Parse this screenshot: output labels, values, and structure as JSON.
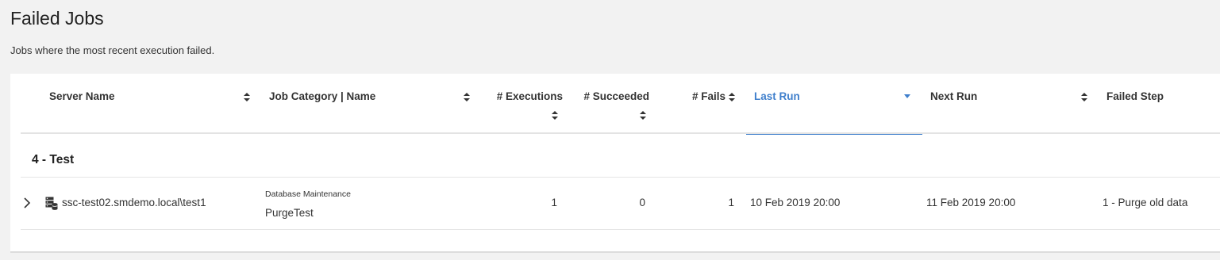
{
  "page": {
    "title": "Failed Jobs",
    "subtitle": "Jobs where the most recent execution failed."
  },
  "table": {
    "columns": [
      {
        "key": "server_name",
        "label": "Server Name",
        "sort": "none"
      },
      {
        "key": "job",
        "label": "Job Category | Name",
        "sort": "none"
      },
      {
        "key": "executions",
        "label": "# Executions",
        "sort": "none"
      },
      {
        "key": "succeeded",
        "label": "# Succeeded",
        "sort": "none"
      },
      {
        "key": "fails",
        "label": "# Fails",
        "sort": "none"
      },
      {
        "key": "last_run",
        "label": "Last Run",
        "sort": "descending"
      },
      {
        "key": "next_run",
        "label": "Next Run",
        "sort": "none"
      },
      {
        "key": "failed_step",
        "label": "Failed Step",
        "sort": "none"
      }
    ],
    "groups": [
      {
        "label": "4 - Test",
        "rows": [
          {
            "server_name": "ssc-test02.smdemo.local\\test1",
            "job_category": "Database Maintenance",
            "job_name": "PurgeTest",
            "executions": "1",
            "succeeded": "0",
            "fails": "1",
            "last_run": "10 Feb 2019 20:00",
            "next_run": "11 Feb 2019 20:00",
            "failed_step": "1 - Purge old data"
          }
        ]
      }
    ]
  },
  "icons": {
    "sort": "sort-both-icon",
    "sort_active": "sort-descending-icon",
    "expand": "chevron-right-icon",
    "server": "server-stack-icon"
  },
  "colors": {
    "accent": "#3f7fcc",
    "background": "#f2f2f2",
    "card": "#ffffff"
  }
}
